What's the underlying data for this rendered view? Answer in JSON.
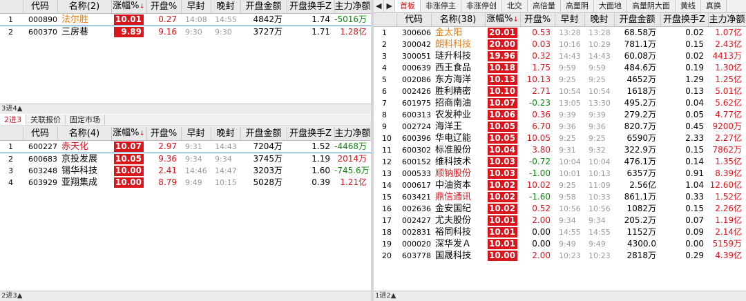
{
  "top_left": {
    "headers": [
      "",
      "代码",
      "名称(2)",
      "涨幅%",
      "开盘%",
      "早封",
      "晚封",
      "开盘金额",
      "开盘换手Z",
      "主力净额"
    ],
    "sort_mark": "↓",
    "rows": [
      {
        "idx": "1",
        "code": "000890",
        "name": "法尔胜",
        "chg": "10.01",
        "open": "0.27",
        "early": "14:08",
        "late": "14:55",
        "amt": "4842万",
        "turn": "1.74",
        "net": "-5016万"
      },
      {
        "idx": "2",
        "code": "600370",
        "name": "三房巷",
        "chg": "9.89",
        "open": "9.16",
        "early": "9:30",
        "late": "9:30",
        "amt": "3727万",
        "turn": "1.71",
        "net": "1.28亿"
      }
    ],
    "status": "3进4▲"
  },
  "bottom_left": {
    "tabs": [
      "2进3",
      "关联报价",
      "固定市场"
    ],
    "headers": [
      "",
      "代码",
      "名称(4)",
      "涨幅%",
      "开盘%",
      "早封",
      "晚封",
      "开盘金额",
      "开盘换手Z",
      "主力净额"
    ],
    "sort_mark": "↓",
    "rows": [
      {
        "idx": "1",
        "code": "600227",
        "name": "赤天化",
        "chg": "10.07",
        "open": "2.97",
        "early": "9:31",
        "late": "14:43",
        "amt": "7204万",
        "turn": "1.52",
        "net": "-4468万"
      },
      {
        "idx": "2",
        "code": "600683",
        "name": "京投发展",
        "chg": "10.05",
        "open": "9.36",
        "early": "9:34",
        "late": "9:34",
        "amt": "3745万",
        "turn": "1.19",
        "net": "2014万"
      },
      {
        "idx": "3",
        "code": "603248",
        "name": "锡华科技",
        "chg": "10.00",
        "open": "2.41",
        "early": "14:46",
        "late": "14:47",
        "amt": "3203万",
        "turn": "1.60",
        "net": "-745.6万"
      },
      {
        "idx": "4",
        "code": "603929",
        "name": "亚翔集成",
        "chg": "10.00",
        "open": "8.79",
        "early": "9:49",
        "late": "10:15",
        "amt": "5028万",
        "turn": "0.39",
        "net": "1.21亿"
      }
    ],
    "status": "2进3▲"
  },
  "right": {
    "tabs": [
      "首板",
      "非涨停主",
      "非涨停创",
      "北交",
      "高倍量",
      "高量阴",
      "大面地",
      "高量阴大面",
      "黄线",
      "真换"
    ],
    "headers": [
      "",
      "代码",
      "名称(38)",
      "涨幅%",
      "开盘%",
      "早封",
      "晚封",
      "开盘金额",
      "开盘换手Z",
      "主力净额"
    ],
    "sort_mark": "↓",
    "rows": [
      {
        "idx": "1",
        "code": "300606",
        "name": "金太阳",
        "nc": "orange",
        "chg": "20.01",
        "open": "0.53",
        "early": "13:28",
        "late": "13:28",
        "amt": "68.58万",
        "turn": "0.02",
        "net": "1.07亿"
      },
      {
        "idx": "2",
        "code": "300042",
        "name": "朗科科技",
        "nc": "orange",
        "chg": "20.00",
        "open": "0.03",
        "early": "10:16",
        "late": "10:29",
        "amt": "781.1万",
        "turn": "0.15",
        "net": "2.43亿"
      },
      {
        "idx": "3",
        "code": "300051",
        "name": "琏升科技",
        "nc": "",
        "chg": "19.96",
        "open": "0.32",
        "early": "14:43",
        "late": "14:43",
        "amt": "60.08万",
        "turn": "0.02",
        "net": "4413万"
      },
      {
        "idx": "4",
        "code": "000639",
        "name": "西王食品",
        "nc": "",
        "chg": "10.18",
        "open": "1.75",
        "early": "9:59",
        "late": "9:59",
        "amt": "484.6万",
        "turn": "0.19",
        "net": "1.30亿"
      },
      {
        "idx": "5",
        "code": "002086",
        "name": "东方海洋",
        "nc": "",
        "chg": "10.13",
        "open": "10.13",
        "early": "9:25",
        "late": "9:25",
        "amt": "4652万",
        "turn": "1.29",
        "net": "1.25亿"
      },
      {
        "idx": "6",
        "code": "002426",
        "name": "胜利精密",
        "nc": "",
        "chg": "10.10",
        "open": "2.71",
        "early": "10:54",
        "late": "10:54",
        "amt": "1618万",
        "turn": "0.13",
        "net": "5.01亿"
      },
      {
        "idx": "7",
        "code": "601975",
        "name": "招商南油",
        "nc": "",
        "chg": "10.07",
        "open": "-0.23",
        "early": "13:05",
        "late": "13:30",
        "amt": "495.2万",
        "turn": "0.04",
        "net": "5.62亿"
      },
      {
        "idx": "8",
        "code": "600313",
        "name": "农发种业",
        "nc": "",
        "chg": "10.06",
        "open": "0.36",
        "early": "9:39",
        "late": "9:39",
        "amt": "279.2万",
        "turn": "0.05",
        "net": "4.77亿"
      },
      {
        "idx": "9",
        "code": "002724",
        "name": "海洋王",
        "nc": "",
        "chg": "10.05",
        "open": "6.70",
        "early": "9:36",
        "late": "9:36",
        "amt": "820.7万",
        "turn": "0.45",
        "net": "9200万"
      },
      {
        "idx": "10",
        "code": "600396",
        "name": "华电辽能",
        "nc": "",
        "chg": "10.05",
        "open": "10.05",
        "early": "9:25",
        "late": "9:25",
        "amt": "6590万",
        "turn": "2.33",
        "net": "2.27亿"
      },
      {
        "idx": "11",
        "code": "600302",
        "name": "标准股份",
        "nc": "",
        "chg": "10.04",
        "open": "3.80",
        "early": "9:31",
        "late": "9:32",
        "amt": "322.9万",
        "turn": "0.15",
        "net": "7862万"
      },
      {
        "idx": "12",
        "code": "600152",
        "name": "维科技术",
        "nc": "",
        "chg": "10.03",
        "open": "-0.72",
        "early": "10:04",
        "late": "10:04",
        "amt": "476.1万",
        "turn": "0.14",
        "net": "1.35亿"
      },
      {
        "idx": "13",
        "code": "000533",
        "name": "顺钠股份",
        "nc": "red",
        "chg": "10.03",
        "open": "-1.00",
        "early": "10:01",
        "late": "10:13",
        "amt": "6357万",
        "turn": "0.91",
        "net": "8.39亿"
      },
      {
        "idx": "14",
        "code": "000617",
        "name": "中油资本",
        "nc": "",
        "chg": "10.02",
        "open": "10.02",
        "early": "9:25",
        "late": "11:09",
        "amt": "2.56亿",
        "turn": "1.04",
        "net": "12.60亿"
      },
      {
        "idx": "15",
        "code": "603421",
        "name": "鼎信通讯",
        "nc": "red",
        "chg": "10.02",
        "open": "-1.60",
        "early": "9:58",
        "late": "10:33",
        "amt": "861.1万",
        "turn": "0.33",
        "net": "1.52亿"
      },
      {
        "idx": "16",
        "code": "002636",
        "name": "金安国纪",
        "nc": "",
        "chg": "10.02",
        "open": "0.52",
        "early": "10:56",
        "late": "10:56",
        "amt": "1082万",
        "turn": "0.15",
        "net": "2.26亿"
      },
      {
        "idx": "17",
        "code": "002427",
        "name": "尤夫股份",
        "nc": "",
        "chg": "10.01",
        "open": "2.00",
        "early": "9:34",
        "late": "9:34",
        "amt": "205.2万",
        "turn": "0.07",
        "net": "1.19亿"
      },
      {
        "idx": "18",
        "code": "002831",
        "name": "裕同科技",
        "nc": "",
        "chg": "10.01",
        "open": "0.00",
        "early": "14:55",
        "late": "14:55",
        "amt": "1152万",
        "turn": "0.09",
        "net": "2.14亿"
      },
      {
        "idx": "19",
        "code": "000020",
        "name": "深华发Ａ",
        "nc": "",
        "chg": "10.01",
        "open": "0.00",
        "early": "9:49",
        "late": "9:49",
        "amt": "4300.0",
        "turn": "0.00",
        "net": "5159万"
      },
      {
        "idx": "20",
        "code": "603778",
        "name": "国晟科技",
        "nc": "",
        "chg": "10.00",
        "open": "2.00",
        "early": "10:23",
        "late": "10:23",
        "amt": "2818万",
        "turn": "0.29",
        "net": "4.39亿"
      }
    ],
    "status": "1进2▲",
    "nav_left": "◀",
    "nav_right": "▶"
  }
}
